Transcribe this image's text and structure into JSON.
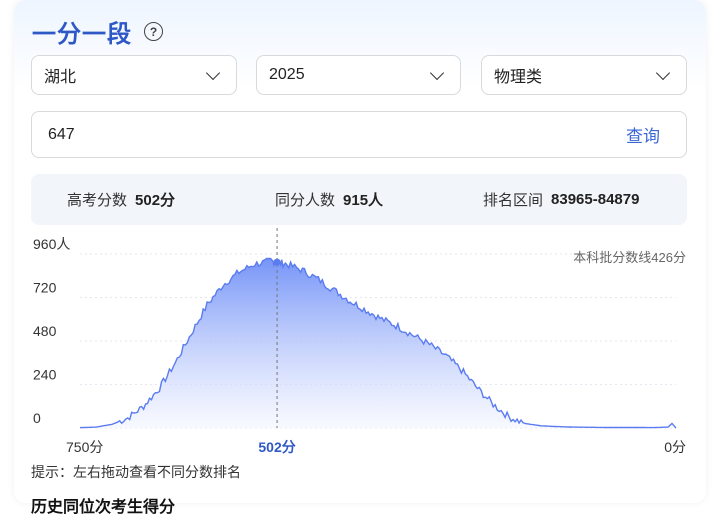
{
  "title": "一分一段",
  "help_icon": "question-circle-icon",
  "filters": {
    "province": "湖北",
    "year": "2025",
    "category": "物理类"
  },
  "score_input": {
    "value": "647"
  },
  "query_label": "查询",
  "stats": {
    "score_label": "高考分数",
    "score_value": "502分",
    "same_label": "同分人数",
    "same_value": "915人",
    "rank_label": "排名区间",
    "rank_value": "83965-84879"
  },
  "chart_data": {
    "type": "area",
    "x_axis_reversed": true,
    "xlim": [
      750,
      0
    ],
    "ylim": [
      0,
      960
    ],
    "y_ticks": [
      "960人",
      "720",
      "480",
      "240",
      "0"
    ],
    "x_tick_left": "750分",
    "x_tick_mid": "502分",
    "x_tick_right": "0分",
    "annotation": "本科批分数线426分",
    "highlight": {
      "x": 502,
      "y": 915
    },
    "x": [
      750,
      730,
      710,
      690,
      670,
      650,
      630,
      610,
      590,
      570,
      550,
      530,
      510,
      502,
      490,
      470,
      450,
      430,
      410,
      390,
      370,
      350,
      330,
      310,
      290,
      270,
      250,
      230,
      210,
      190,
      170,
      150,
      130,
      110,
      90,
      70,
      50,
      30,
      10,
      5,
      0
    ],
    "values": [
      2,
      5,
      20,
      55,
      120,
      220,
      360,
      520,
      680,
      790,
      860,
      905,
      920,
      915,
      905,
      870,
      820,
      760,
      700,
      650,
      600,
      560,
      510,
      460,
      400,
      320,
      220,
      130,
      60,
      25,
      12,
      8,
      5,
      4,
      3,
      3,
      3,
      2,
      5,
      25,
      0
    ],
    "colors": {
      "line": "#5b7cf0",
      "fill_top": "#6f8ff7",
      "fill_bottom": "#f4f6ff",
      "grid": "#e3e7f0",
      "accent": "#2f58c7"
    }
  },
  "hint": "提示：左右拖动查看不同分数排名",
  "next_section_title": "历史同位次考生得分"
}
